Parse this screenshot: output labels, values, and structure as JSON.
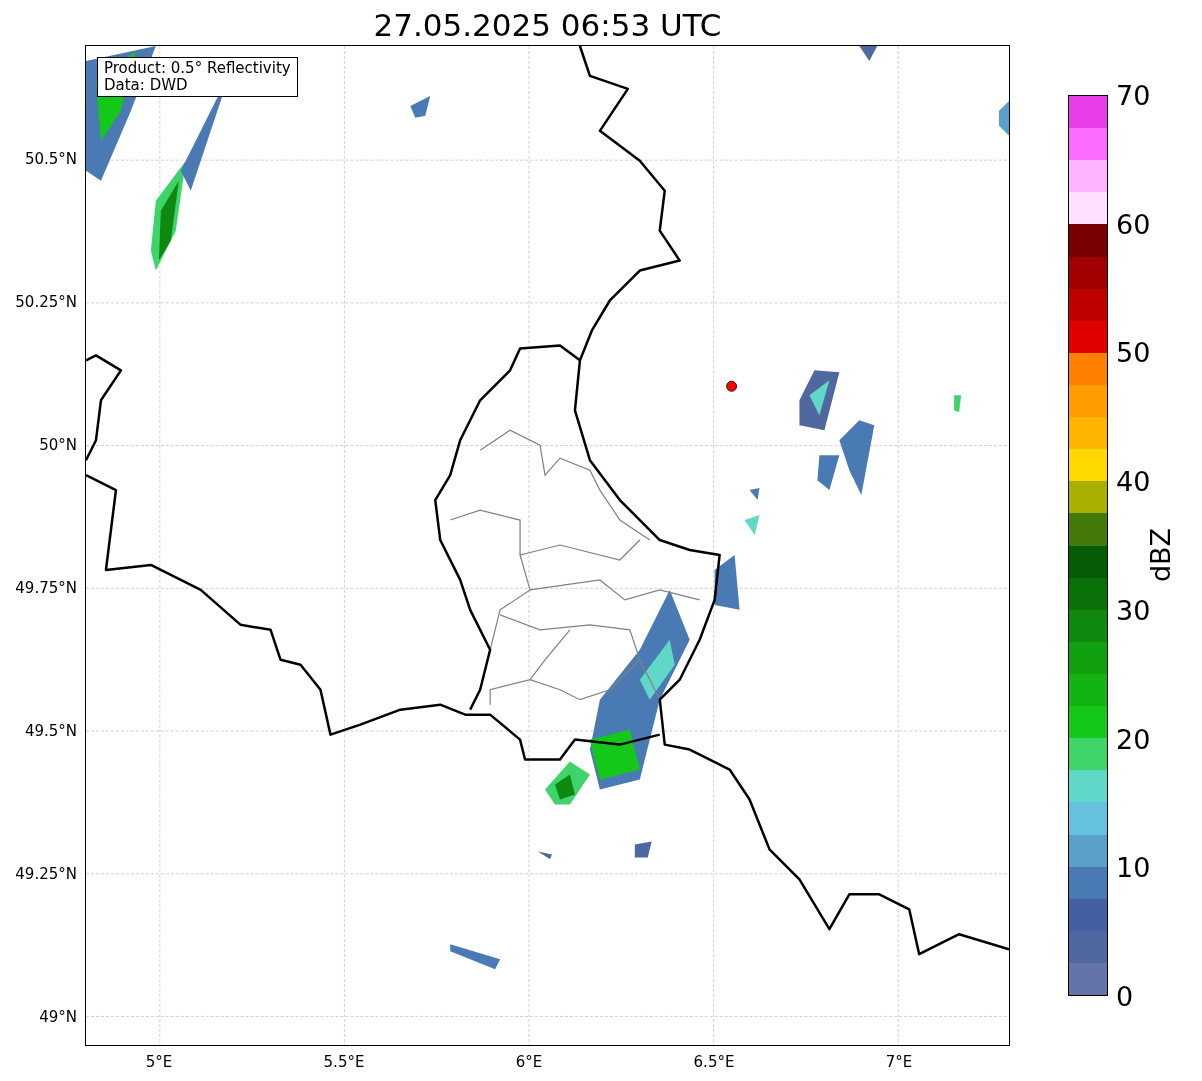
{
  "title": "27.05.2025 06:53 UTC",
  "legend": {
    "lines": [
      "Product: 0.5° Reflectivity",
      "Data: DWD"
    ]
  },
  "yticks": [
    "50.5°N",
    "50.25°N",
    "50°N",
    "49.75°N",
    "49.5°N",
    "49.25°N",
    "49°N"
  ],
  "xticks": [
    "5°E",
    "5.5°E",
    "6°E",
    "6.5°E",
    "7°E"
  ],
  "colorbar": {
    "label": "dBZ",
    "ticks": [
      "70",
      "60",
      "50",
      "40",
      "30",
      "20",
      "10",
      "0"
    ],
    "bands": [
      {
        "color": "#e83ce8"
      },
      {
        "color": "#fc6cfc"
      },
      {
        "color": "#ffb4ff"
      },
      {
        "color": "#ffe0ff"
      },
      {
        "color": "#780000"
      },
      {
        "color": "#a00000"
      },
      {
        "color": "#c00000"
      },
      {
        "color": "#e00000"
      },
      {
        "color": "#ff8000"
      },
      {
        "color": "#ff9c00"
      },
      {
        "color": "#ffb400"
      },
      {
        "color": "#ffd800"
      },
      {
        "color": "#aab000"
      },
      {
        "color": "#447a0a"
      },
      {
        "color": "#065c06"
      },
      {
        "color": "#0a700a"
      },
      {
        "color": "#0e880e"
      },
      {
        "color": "#10a010"
      },
      {
        "color": "#12b414"
      },
      {
        "color": "#14c81a"
      },
      {
        "color": "#3ed46a"
      },
      {
        "color": "#60d8c8"
      },
      {
        "color": "#66c2dc"
      },
      {
        "color": "#5aa0c8"
      },
      {
        "color": "#4a7ab4"
      },
      {
        "color": "#4460a4"
      },
      {
        "color": "#5068a0"
      },
      {
        "color": "#6474a8"
      }
    ]
  }
}
